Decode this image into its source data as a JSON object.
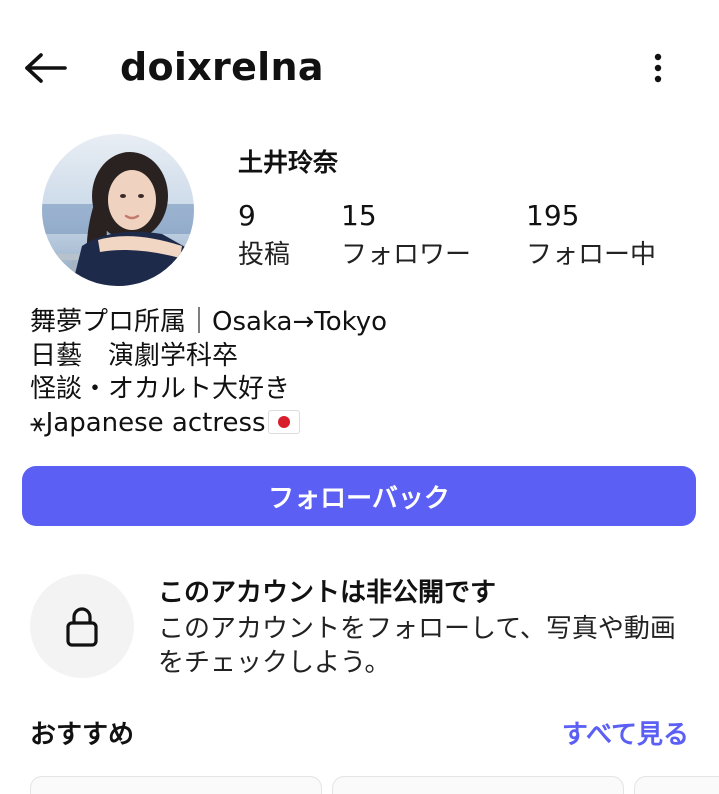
{
  "header": {
    "username": "doixrelna",
    "back_icon": "arrow-left-icon",
    "more_icon": "vertical-dots-icon"
  },
  "profile": {
    "display_name": "土井玲奈",
    "stats": [
      {
        "value": "9",
        "label": "投稿"
      },
      {
        "value": "15",
        "label": "フォロワー"
      },
      {
        "value": "195",
        "label": "フォロー中"
      }
    ],
    "bio_lines": [
      "舞夢プロ所属｜Osaka→Tokyo",
      "日藝　演劇学科卒",
      "怪談・オカルト大好き",
      "⚹Japanese actress"
    ]
  },
  "actions": {
    "follow_back_label": "フォローバック",
    "accent_color": "#5b5ff3"
  },
  "private_notice": {
    "title": "このアカウントは非公開です",
    "description": "このアカウントをフォローして、写真や動画をチェックしよう。",
    "icon": "lock-icon"
  },
  "suggestions": {
    "title": "おすすめ",
    "see_all_label": "すべて見る"
  }
}
